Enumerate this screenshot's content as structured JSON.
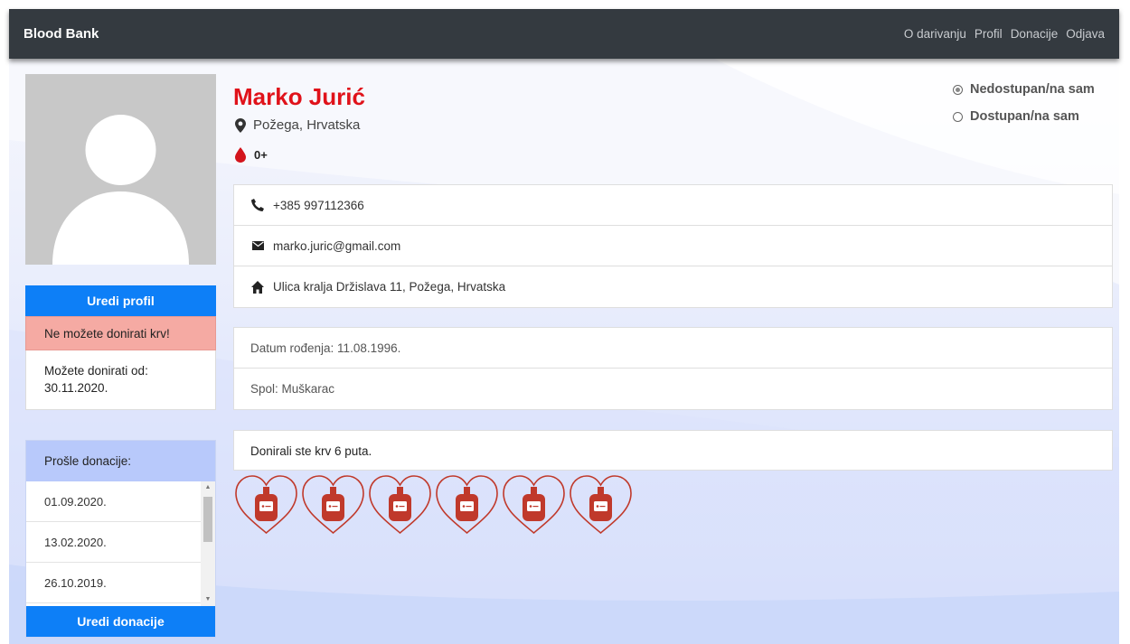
{
  "navbar": {
    "brand": "Blood Bank",
    "links": [
      "O darivanju",
      "Profil",
      "Donacije",
      "Odjava"
    ]
  },
  "profile": {
    "name": "Marko Jurić",
    "location": "Požega, Hrvatska",
    "blood_type": "0+",
    "location_icon": "map-pin-icon",
    "blood_icon": "blood-drop-icon"
  },
  "availability": {
    "options": [
      {
        "label": "Nedostupan/na sam",
        "checked": true
      },
      {
        "label": "Dostupan/na sam",
        "checked": false
      }
    ]
  },
  "contact": {
    "phone": "+385 997112366",
    "email": "marko.juric@gmail.com",
    "address": "Ulica kralja Držislava 11, Požega, Hrvatska"
  },
  "details": {
    "birth_date": "Datum rođenja: 11.08.1996.",
    "gender": "Spol: Muškarac"
  },
  "sidebar": {
    "edit_profile_label": "Uredi profil",
    "cannot_donate": "Ne možete donirati krv!",
    "can_donate_from": "Možete donirati od: 30.11.2020.",
    "past_donations_title": "Prošle donacije:",
    "past_donations": [
      "01.09.2020.",
      "13.02.2020.",
      "26.10.2019."
    ],
    "edit_donations_label": "Uredi donacije"
  },
  "donations": {
    "summary": "Donirali ste krv 6 puta.",
    "count": 6
  },
  "colors": {
    "navbar": "#343a40",
    "accent_blue": "#0d7ff7",
    "name_red": "#e0121a",
    "alert_red": "#f5aaa3",
    "donations_header": "#b8c9fb",
    "heart_red": "#c0392b"
  }
}
